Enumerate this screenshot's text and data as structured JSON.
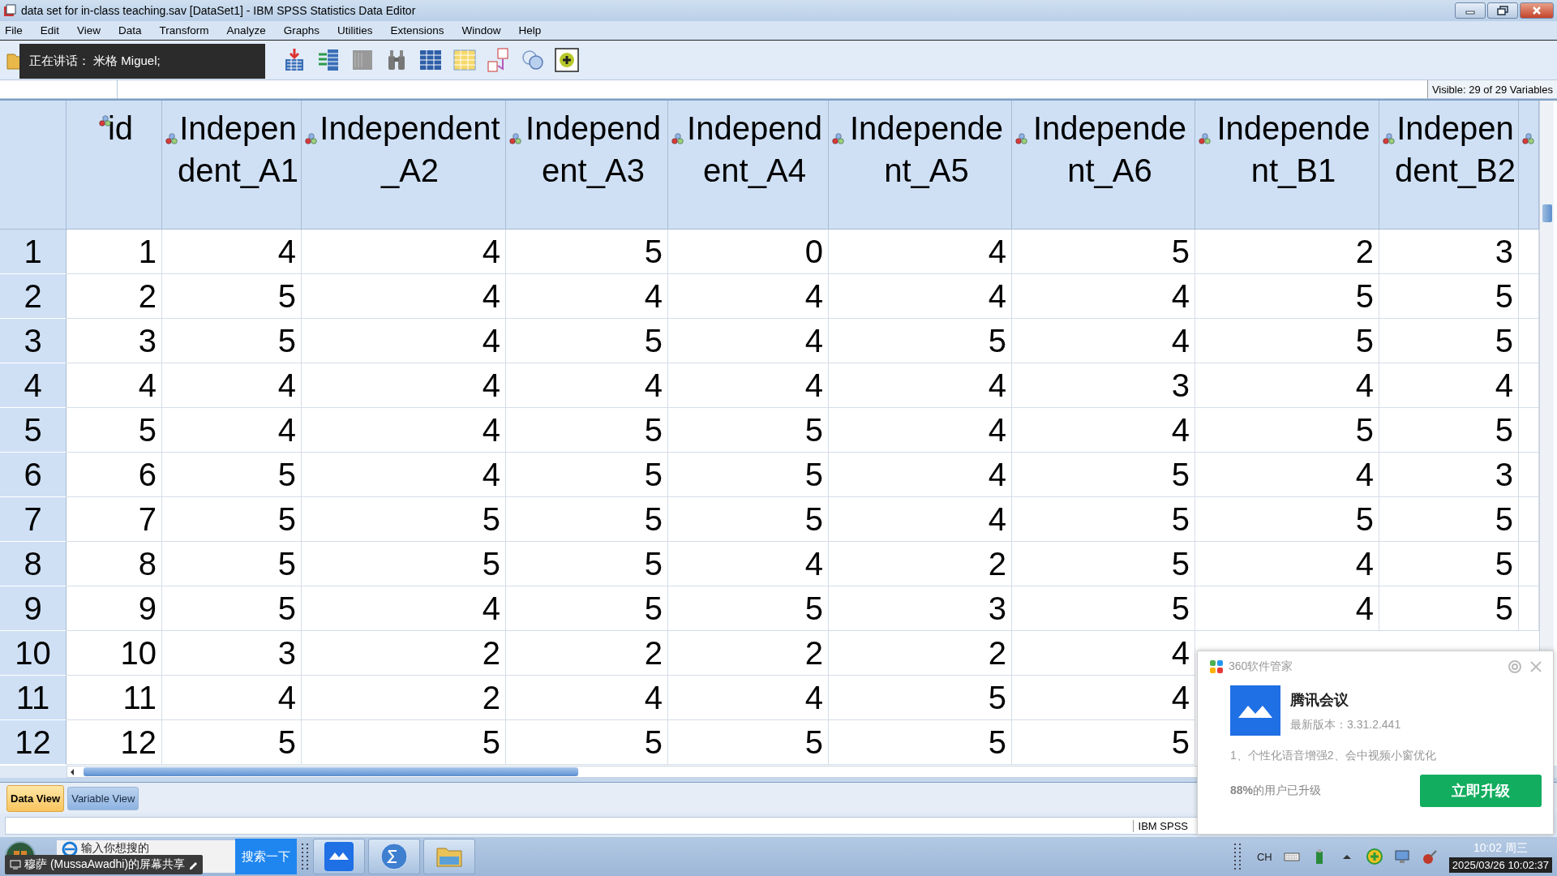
{
  "window": {
    "title": "data set for in-class teaching.sav [DataSet1] - IBM SPSS Statistics Data Editor"
  },
  "menu": [
    "File",
    "Edit",
    "View",
    "Data",
    "Transform",
    "Analyze",
    "Graphs",
    "Utilities",
    "Extensions",
    "Window",
    "Help"
  ],
  "speaker_overlay": {
    "text": "正在讲话：  米格 Miguel;"
  },
  "cell_editor": {
    "visible_count": "Visible: 29 of 29 Variables"
  },
  "grid": {
    "columns": [
      "id",
      "Independent_A1",
      "Independent_A2",
      "Independent_A3",
      "Independent_A4",
      "Independent_A5",
      "Independent_A6",
      "Independent_B1",
      "Independent_B2"
    ],
    "rows": [
      {
        "number": "1",
        "cells": [
          "1",
          "4",
          "4",
          "5",
          "0",
          "4",
          "5",
          "2",
          "3"
        ]
      },
      {
        "number": "2",
        "cells": [
          "2",
          "5",
          "4",
          "4",
          "4",
          "4",
          "4",
          "5",
          "5"
        ]
      },
      {
        "number": "3",
        "cells": [
          "3",
          "5",
          "4",
          "5",
          "4",
          "5",
          "4",
          "5",
          "5"
        ]
      },
      {
        "number": "4",
        "cells": [
          "4",
          "4",
          "4",
          "4",
          "4",
          "4",
          "3",
          "4",
          "4"
        ]
      },
      {
        "number": "5",
        "cells": [
          "5",
          "4",
          "4",
          "5",
          "5",
          "4",
          "4",
          "5",
          "5"
        ]
      },
      {
        "number": "6",
        "cells": [
          "6",
          "5",
          "4",
          "5",
          "5",
          "4",
          "5",
          "4",
          "3"
        ]
      },
      {
        "number": "7",
        "cells": [
          "7",
          "5",
          "5",
          "5",
          "5",
          "4",
          "5",
          "5",
          "5"
        ]
      },
      {
        "number": "8",
        "cells": [
          "8",
          "5",
          "5",
          "5",
          "4",
          "2",
          "5",
          "4",
          "5"
        ]
      },
      {
        "number": "9",
        "cells": [
          "9",
          "5",
          "4",
          "5",
          "5",
          "3",
          "5",
          "4",
          "5"
        ]
      },
      {
        "number": "10",
        "cells": [
          "10",
          "3",
          "2",
          "2",
          "2",
          "2",
          "4"
        ]
      },
      {
        "number": "11",
        "cells": [
          "11",
          "4",
          "2",
          "4",
          "4",
          "5",
          "4"
        ]
      },
      {
        "number": "12",
        "cells": [
          "12",
          "5",
          "5",
          "5",
          "5",
          "5",
          "5"
        ]
      }
    ]
  },
  "tabs": [
    {
      "label": "Data View",
      "selected": true
    },
    {
      "label": "Variable View",
      "selected": false
    }
  ],
  "status_bar": {
    "text": "IBM SPSS"
  },
  "notification": {
    "source": "360软件管家",
    "app_name": "腾讯会议",
    "version": "最新版本：3.31.2.441",
    "features": "1、个性化语音增强2、会中视频小窗优化",
    "adoption": "**88%**的用户已升级",
    "button": "立即升级"
  },
  "taskbar": {
    "search_value": "输入你想搜的",
    "search_button": "搜索一下",
    "share_label": "穆萨 (MussaAwadhi)的屏幕共享",
    "input_language": "CH",
    "clock_time": "10:02 周三",
    "clock_datetime": "2025/03/26 10:02:37"
  }
}
